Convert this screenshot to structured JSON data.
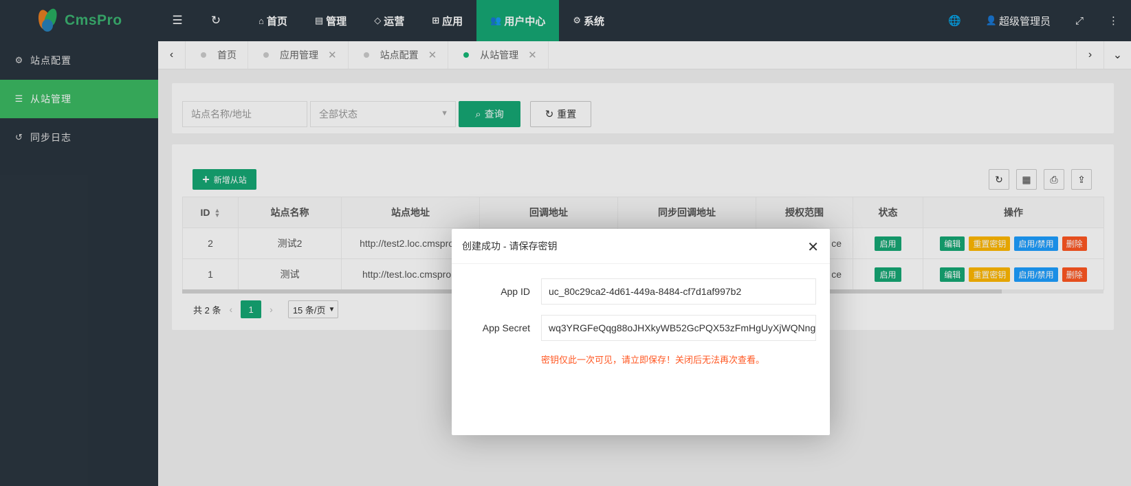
{
  "brand": {
    "name": "CmsPro"
  },
  "sidebar": {
    "items": [
      {
        "label": "站点配置",
        "icon": "gear-icon",
        "active": false
      },
      {
        "label": "从站管理",
        "icon": "list-icon",
        "active": true
      },
      {
        "label": "同步日志",
        "icon": "history-icon",
        "active": false
      }
    ]
  },
  "topnav": {
    "items": [
      {
        "label": "首页",
        "icon": "home-icon"
      },
      {
        "label": "管理",
        "icon": "calendar-icon"
      },
      {
        "label": "运营",
        "icon": "cube-icon"
      },
      {
        "label": "应用",
        "icon": "apps-icon"
      },
      {
        "label": "用户中心",
        "icon": "users-icon",
        "active": true
      },
      {
        "label": "系统",
        "icon": "gear-icon"
      }
    ],
    "user": "超级管理员"
  },
  "tabs": [
    {
      "label": "首页",
      "active": false,
      "closable": false
    },
    {
      "label": "应用管理",
      "active": false,
      "closable": true
    },
    {
      "label": "站点配置",
      "active": false,
      "closable": true
    },
    {
      "label": "从站管理",
      "active": true,
      "closable": true
    }
  ],
  "search": {
    "name_placeholder": "站点名称/地址",
    "status_placeholder": "全部状态",
    "query_label": "查询",
    "reset_label": "重置"
  },
  "toolbar": {
    "add_label": "新增从站"
  },
  "table": {
    "headers": [
      "ID",
      "站点名称",
      "站点地址",
      "回调地址",
      "同步回调地址",
      "授权范围",
      "状态",
      "操作"
    ],
    "rows": [
      {
        "id": "2",
        "name": "测试2",
        "url": "http://test2.loc.cmspro.c",
        "scope": "ce",
        "status": "启用"
      },
      {
        "id": "1",
        "name": "测试",
        "url": "http://test.loc.cmspro.c",
        "scope": "ce",
        "status": "启用"
      }
    ],
    "actions": {
      "edit": "编辑",
      "reset_key": "重置密钥",
      "toggle": "启用/禁用",
      "delete": "删除"
    }
  },
  "pager": {
    "total": "共 2 条",
    "current": "1",
    "page_size": "15 条/页"
  },
  "dialog": {
    "title": "创建成功 - 请保存密钥",
    "app_id_label": "App ID",
    "app_id": "uc_80c29ca2-4d61-449a-8484-cf7d1af997b2",
    "app_secret_label": "App Secret",
    "app_secret": "wq3YRGFeQqg88oJHXkyWB52GcPQX53zFmHgUyXjWQNng",
    "warning": "密钥仅此一次可见，请立即保存！关闭后无法再次查看。"
  },
  "colors": {
    "primary": "#16a874",
    "sidebar_bg": "#2a353f",
    "sidebar_active": "#3cb963",
    "warn": "#ff5722"
  }
}
